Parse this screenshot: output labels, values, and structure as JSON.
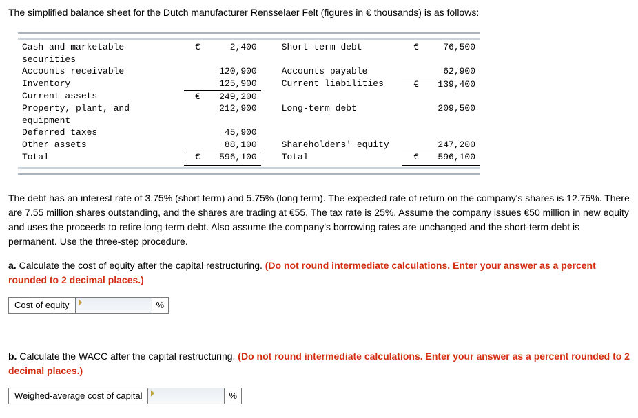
{
  "intro": "The simplified balance sheet for the Dutch manufacturer Rensselaer Felt (figures in € thousands) is as follows:",
  "sheet": {
    "left": [
      {
        "label": "Cash and marketable securities",
        "cur": "€",
        "amt": "2,400"
      },
      {
        "label": "Accounts receivable",
        "cur": "",
        "amt": "120,900"
      },
      {
        "label": "Inventory",
        "cur": "",
        "amt": "125,900",
        "underline": true
      },
      {
        "label": "Current assets",
        "cur": "€",
        "amt": "249,200"
      },
      {
        "label": "Property, plant, and equipment",
        "cur": "",
        "amt": "212,900"
      },
      {
        "label": "Deferred taxes",
        "cur": "",
        "amt": "45,900"
      },
      {
        "label": "Other assets",
        "cur": "",
        "amt": "88,100",
        "underline": true
      },
      {
        "label": "Total",
        "cur": "€",
        "amt": "596,100",
        "double": true
      }
    ],
    "right": [
      {
        "label": "Short-term debt",
        "cur": "€",
        "amt": "76,500"
      },
      {
        "label": "Accounts payable",
        "cur": "",
        "amt": "62,900",
        "underline": true
      },
      {
        "label": "Current liabilities",
        "cur": "€",
        "amt": "139,400"
      },
      {
        "label": "",
        "cur": "",
        "amt": ""
      },
      {
        "label": "Long-term debt",
        "cur": "",
        "amt": "209,500"
      },
      {
        "label": "",
        "cur": "",
        "amt": ""
      },
      {
        "label": "Shareholders' equity",
        "cur": "",
        "amt": "247,200",
        "underline": true
      },
      {
        "label": "Total",
        "cur": "€",
        "amt": "596,100",
        "double": true
      }
    ]
  },
  "para2": "The debt has an interest rate of 3.75% (short term) and 5.75% (long term). The expected rate of return on the company's shares is 12.75%. There are 7.55 million shares outstanding, and the shares are trading at €55. The tax rate is 25%. Assume the company issues €50 million in new equity and uses the proceeds to retire long-term debt. Also assume the company's borrowing rates are unchanged and the short-term debt is permanent. Use the three-step procedure.",
  "qa": {
    "prefix": "a.",
    "text": " Calculate the cost of equity after the capital restructuring. ",
    "hint": "(Do not round intermediate calculations. Enter your answer as a percent rounded to 2 decimal places.)",
    "label": "Cost of equity",
    "unit": "%"
  },
  "qb": {
    "prefix": "b.",
    "text": " Calculate the WACC after the capital restructuring. ",
    "hint": "(Do not round intermediate calculations. Enter your answer as a percent rounded to 2 decimal places.)",
    "label": "Weighed-average cost of capital",
    "unit": "%"
  }
}
